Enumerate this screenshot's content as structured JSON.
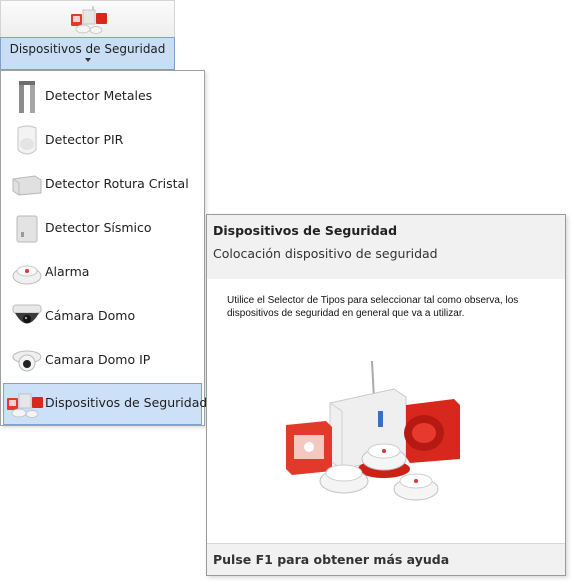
{
  "ribbon": {
    "button_label": "Dispositivos de Seguridad",
    "icon": "security-devices-icon"
  },
  "menu": {
    "items": [
      {
        "label": "Detector Metales",
        "icon": "metal-detector-icon"
      },
      {
        "label": "Detector PIR",
        "icon": "pir-detector-icon"
      },
      {
        "label": "Detector Rotura Cristal",
        "icon": "glass-break-detector-icon"
      },
      {
        "label": "Detector Sísmico",
        "icon": "seismic-detector-icon"
      },
      {
        "label": "Alarma",
        "icon": "alarm-icon"
      },
      {
        "label": "Cámara Domo",
        "icon": "dome-camera-icon"
      },
      {
        "label": "Camara Domo IP",
        "icon": "ip-dome-camera-icon"
      },
      {
        "label": "Dispositivos de Seguridad",
        "icon": "security-devices-icon",
        "selected": true
      }
    ]
  },
  "tooltip": {
    "title": "Dispositivos de Seguridad",
    "subtitle": "Colocación dispositivo de seguridad",
    "body": "Utilice el Selector de Tipos para seleccionar tal como observa, los dispositivos de seguridad en general que va a utilizar.",
    "help": "Pulse F1 para obtener más ayuda",
    "image": "security-devices-illustration"
  },
  "colors": {
    "selection_bg": "#cce0f7",
    "selection_border": "#7da2ce",
    "tooltip_band": "#f1f1f1"
  }
}
